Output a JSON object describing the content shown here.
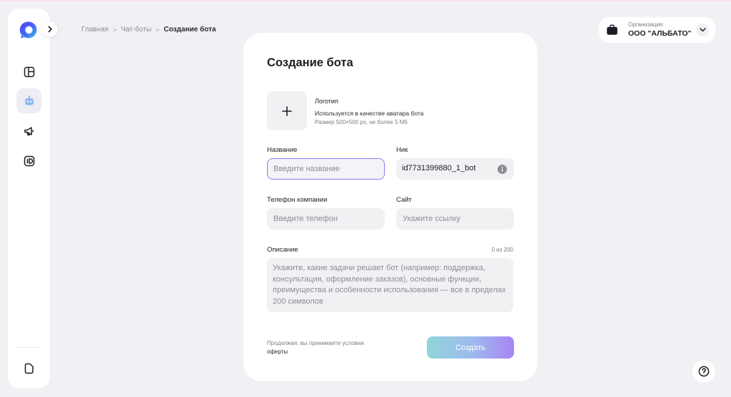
{
  "breadcrumb": {
    "home": "Главная",
    "chatbots": "Чат-боты",
    "current": "Создание бота"
  },
  "sidebar": {
    "items": [
      {
        "icon": "dashboard-icon"
      },
      {
        "icon": "bot-icon",
        "active": true
      },
      {
        "icon": "megaphone-icon"
      },
      {
        "icon": "id-icon"
      }
    ],
    "bottom_icon": "document-icon"
  },
  "org": {
    "caption": "Организация",
    "name": "ООО \"АЛЬБАТО\""
  },
  "form": {
    "title": "Создание бота",
    "logo": {
      "label": "Логотип",
      "hint": "Используется в качестве аватара бота",
      "size": "Размер 500×500 px, не более 5 Мб"
    },
    "name": {
      "label": "Название",
      "placeholder": "Введите название"
    },
    "nick": {
      "label": "Ник",
      "value": "id7731399880_1_bot"
    },
    "phone": {
      "label": "Телефон компании",
      "placeholder": "Введите телефон"
    },
    "site": {
      "label": "Сайт",
      "placeholder": "Укажите ссылку"
    },
    "description": {
      "label": "Описание",
      "counter": "0 из 200",
      "placeholder": "Укажите, какие задачи решает бот (например: поддержка, консультация, оформление заказов), основные функции, преимущества и особенности использования — все в пределах 200 символов"
    },
    "terms": {
      "text": "Продолжая, вы принимаете условия ",
      "link": "оферты"
    },
    "submit_label": "Создать"
  },
  "colors": {
    "accent": "#8b7cf2",
    "gradient_start": "#90d5da",
    "gradient_end": "#a785f2",
    "background": "#f1f0f5"
  }
}
